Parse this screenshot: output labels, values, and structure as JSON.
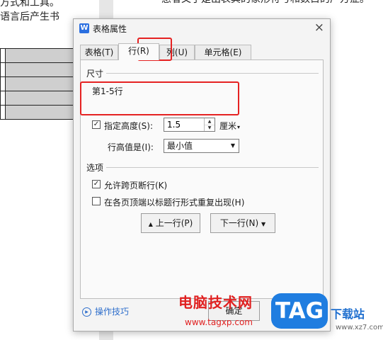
{
  "document": {
    "left_line1": "方式和工具。",
    "left_line2": "语言后产生书",
    "right_line": "惑者又于是出表其的象形符号和数目的产方症。"
  },
  "dialog": {
    "app_icon": "W",
    "title": "表格属性",
    "close_icon": "×",
    "tabs": [
      {
        "label": "表格(T)"
      },
      {
        "label": "行(R)",
        "active": true
      },
      {
        "label": "列(U)"
      },
      {
        "label": "单元格(E)"
      }
    ],
    "size_group": {
      "title": "尺寸",
      "rows_label": "第1-5行",
      "specify_height": {
        "checked": true,
        "check_mark": "✓",
        "label": "指定高度(S):"
      },
      "height_value": "1.5",
      "unit": "厘米",
      "unit_arrow": "▾",
      "row_height_is_label": "行高值是(I):",
      "row_height_is_value": "最小值",
      "select_arrow": "▼"
    },
    "options_group": {
      "title": "选项",
      "allow_break": {
        "checked": true,
        "check_mark": "✓",
        "label": "允许跨页断行(K)"
      },
      "repeat_header": {
        "checked": false,
        "label": "在各页顶端以标题行形式重复出现(H)"
      }
    },
    "buttons": {
      "prev_row_icon": "▲",
      "prev_row": "上一行(P)",
      "next_row": "下一行(N)",
      "next_row_icon": "▼",
      "ok": "确定"
    },
    "tips": {
      "icon": "▶",
      "label": "操作技巧"
    }
  },
  "watermark": {
    "brand_text": "电脑技术网",
    "url": "www.tagxp.com",
    "badge": "TAG",
    "site": "下载站",
    "site2": "www.xz7.com"
  },
  "colors": {
    "highlight": "#e52222",
    "accent": "#2b6fe0",
    "link": "#2f6fcc"
  }
}
